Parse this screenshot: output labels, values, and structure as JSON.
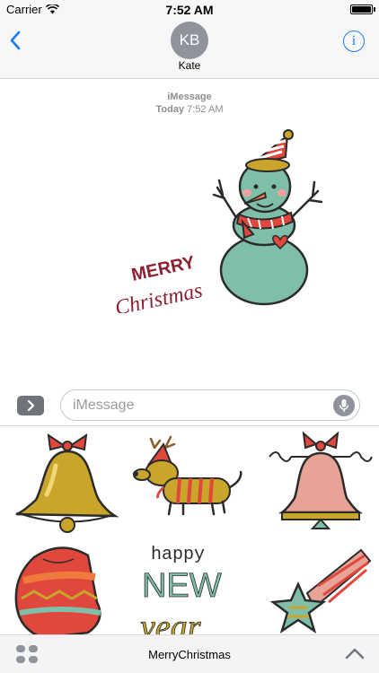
{
  "status_bar": {
    "carrier": "Carrier",
    "time": "7:52 AM"
  },
  "header": {
    "avatar_initials": "KB",
    "contact_name": "Kate",
    "info_label": "i"
  },
  "thread": {
    "service": "iMessage",
    "day": "Today",
    "time": "7:52 AM",
    "sticker_text_line1": "MERRY",
    "sticker_text_line2": "Christmas"
  },
  "compose": {
    "placeholder": "iMessage"
  },
  "drawer": {
    "sticker_new_year_line1": "happy",
    "sticker_new_year_line2": "NEW",
    "sticker_new_year_line3": "year"
  },
  "bottom_bar": {
    "app_name": "MerryChristmas"
  },
  "colors": {
    "accent": "#1a7cf5",
    "snowman": "#7fbfa9",
    "red": "#e0473d",
    "gold": "#c9a52c"
  },
  "icons": [
    "wifi-icon",
    "battery-icon",
    "chevron-left-icon",
    "info-icon",
    "chevron-right-icon",
    "microphone-icon",
    "app-grid-icon",
    "chevron-up-icon"
  ]
}
